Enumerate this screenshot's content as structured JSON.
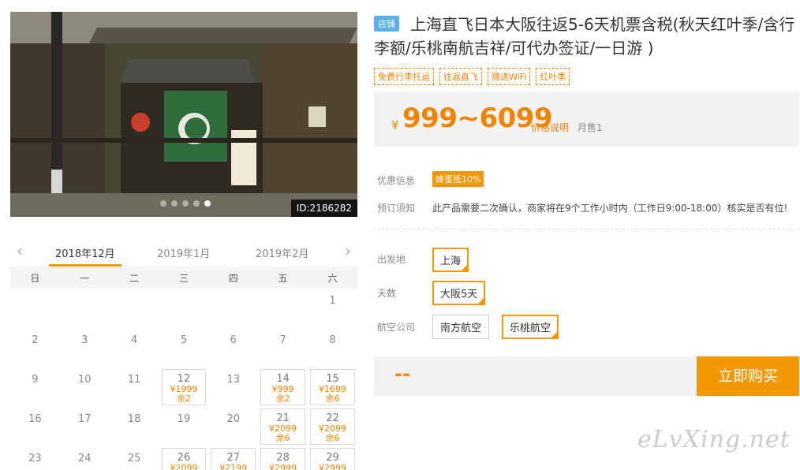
{
  "photo": {
    "id_label": "ID:2186282",
    "slide_count": 5,
    "active_slide": 5
  },
  "calendar": {
    "months": [
      "2018年12月",
      "2019年1月",
      "2019年2月"
    ],
    "active_month": 0,
    "weekdays": [
      "日",
      "一",
      "二",
      "三",
      "四",
      "五",
      "六"
    ],
    "rows": [
      [
        {
          "d": ""
        },
        {
          "d": ""
        },
        {
          "d": ""
        },
        {
          "d": ""
        },
        {
          "d": ""
        },
        {
          "d": ""
        },
        {
          "d": "1"
        }
      ],
      [
        {
          "d": "2"
        },
        {
          "d": "3"
        },
        {
          "d": "4"
        },
        {
          "d": "5"
        },
        {
          "d": "6"
        },
        {
          "d": "7"
        },
        {
          "d": "8"
        }
      ],
      [
        {
          "d": "9"
        },
        {
          "d": "10"
        },
        {
          "d": "11"
        },
        {
          "d": "12",
          "p": "¥1999",
          "r": "余2"
        },
        {
          "d": "13"
        },
        {
          "d": "14",
          "p": "¥999",
          "r": "余2"
        },
        {
          "d": "15",
          "p": "¥1699",
          "r": "余6"
        }
      ],
      [
        {
          "d": "16"
        },
        {
          "d": "17"
        },
        {
          "d": "18"
        },
        {
          "d": "19"
        },
        {
          "d": "20"
        },
        {
          "d": "21",
          "p": "¥2099",
          "r": "余6"
        },
        {
          "d": "22",
          "p": "¥2099",
          "r": "余6"
        }
      ],
      [
        {
          "d": "23"
        },
        {
          "d": "24"
        },
        {
          "d": "25"
        },
        {
          "d": "26",
          "p": "¥2099",
          "r": ""
        },
        {
          "d": "27",
          "p": "¥2199",
          "r": ""
        },
        {
          "d": "28",
          "p": "¥2999",
          "r": ""
        },
        {
          "d": "29",
          "p": "¥2999",
          "r": ""
        }
      ]
    ]
  },
  "product": {
    "shop_tag": "店铺",
    "title": "上海直飞日本大阪往返5-6天机票含税(秋天红叶季/含行李额/乐桃南航吉祥/可代办签证/一日游 )",
    "feature_tags": [
      "免费行李托运",
      "往返直飞",
      "赠送WiFi",
      "红叶季"
    ],
    "price_yen": "¥",
    "price_range": "999~6099",
    "price_note": "价格说明",
    "sold": "月售1"
  },
  "info": {
    "promo_label": "优惠信息",
    "promo_badge": "蜂蜜抵10%",
    "notice_label": "预订须知",
    "notice_text": "此产品需要二次确认，商家将在9个工作小时内（工作日9:00-18:00）核实是否有位!"
  },
  "options": {
    "departure_label": "出发地",
    "departure": [
      "上海"
    ],
    "days_label": "天数",
    "days": [
      "大阪5天"
    ],
    "airline_label": "航空公司",
    "airlines": [
      "南方航空",
      "乐桃航空"
    ]
  },
  "buy": {
    "total": "--",
    "button": "立即购买"
  },
  "watermark": "eLvXing.net",
  "colors": {
    "accent": "#f39800",
    "price": "#f08300",
    "shop_tag": "#5ab0e8"
  }
}
